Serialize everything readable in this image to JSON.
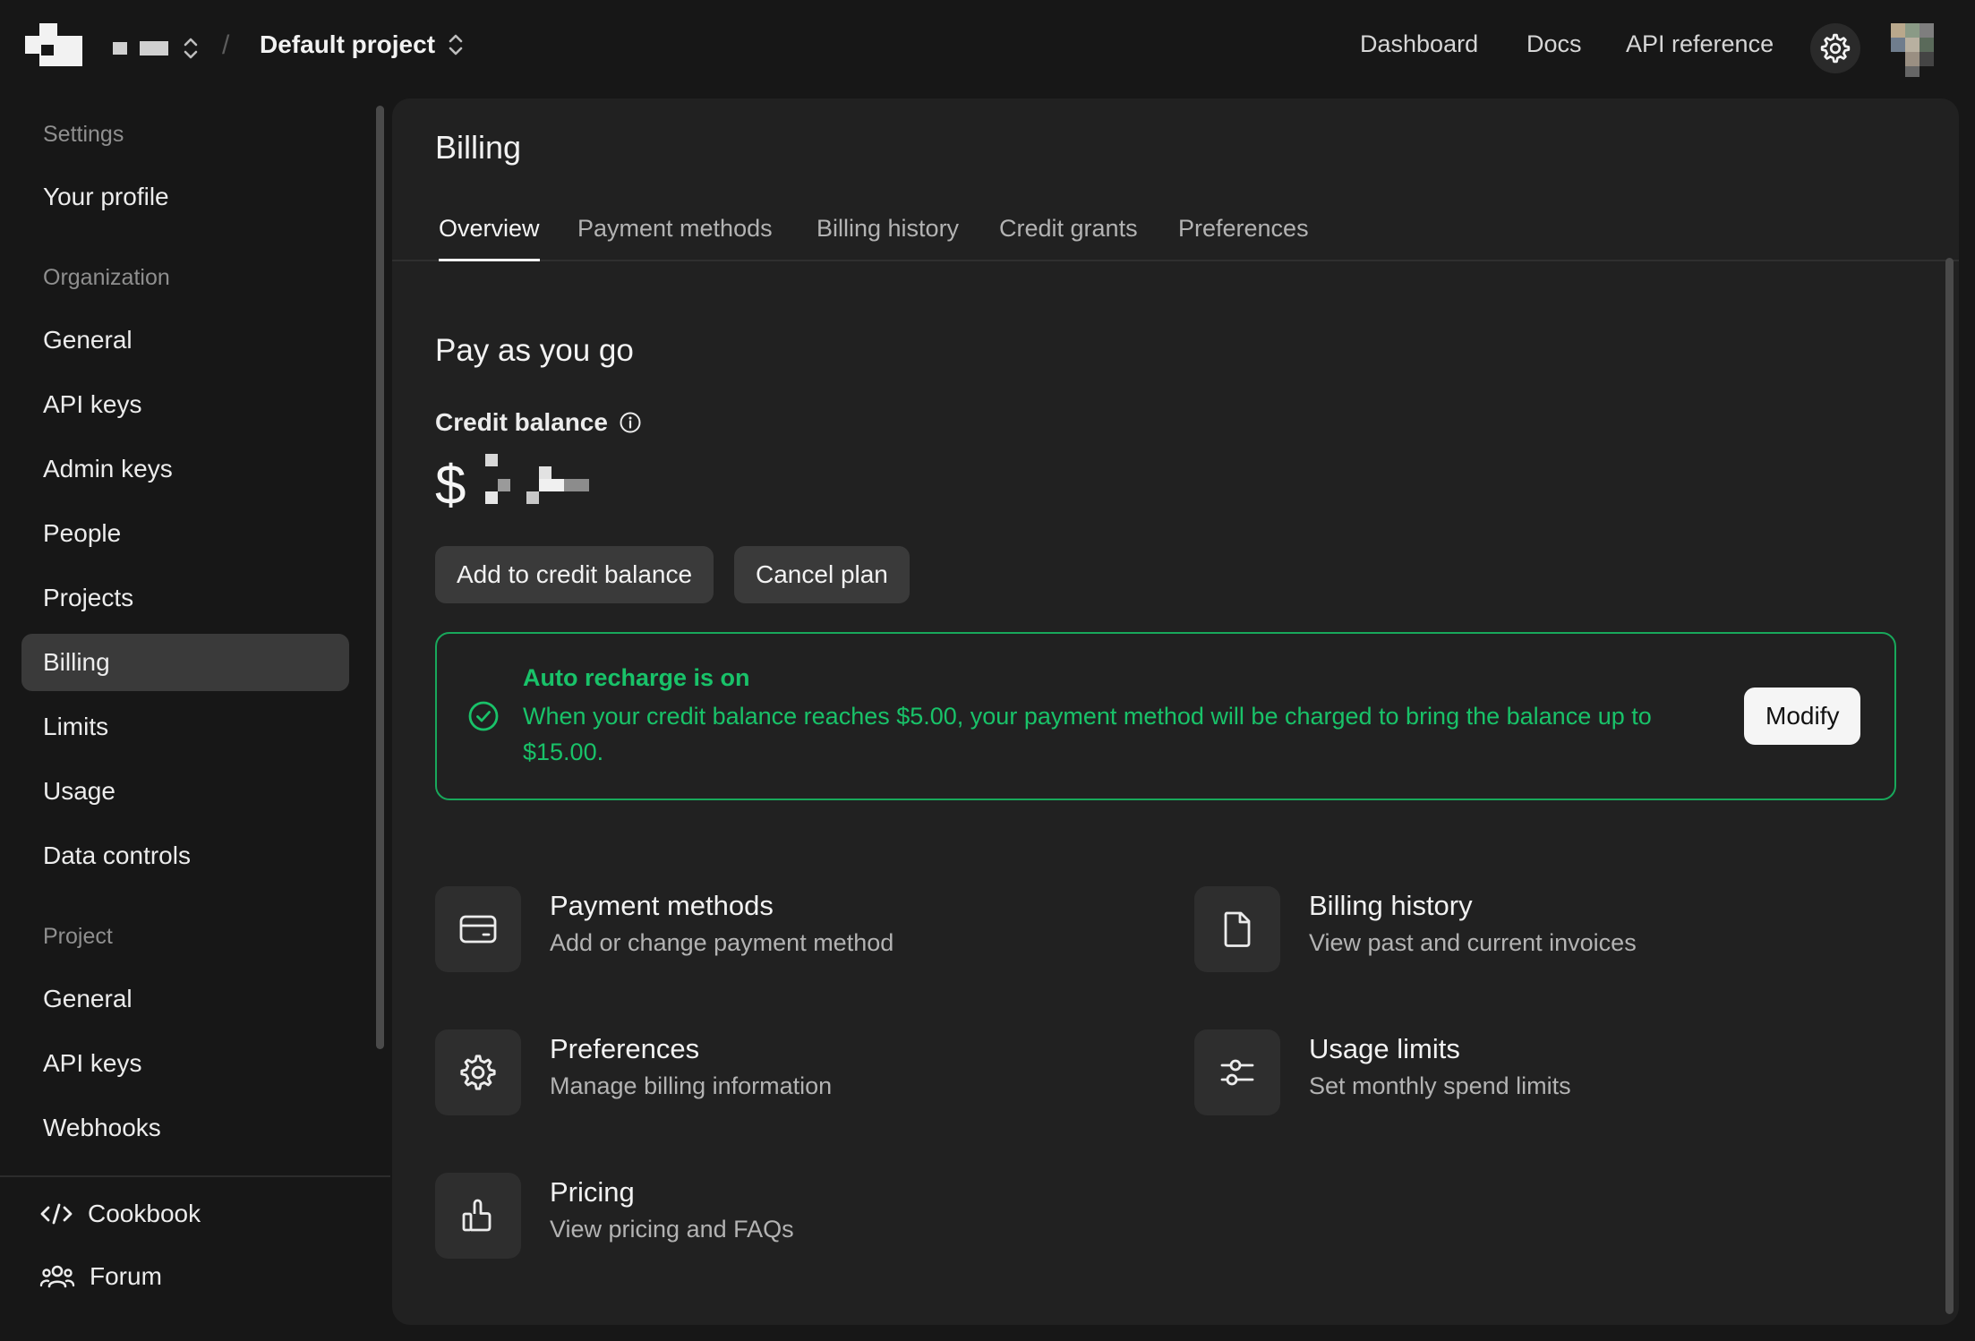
{
  "topbar": {
    "project_name": "Default project",
    "separator": "/",
    "links": [
      "Dashboard",
      "Docs",
      "API reference"
    ]
  },
  "sidebar": {
    "settings_header": "Settings",
    "your_profile": "Your profile",
    "organization_header": "Organization",
    "org_items": [
      "General",
      "API keys",
      "Admin keys",
      "People",
      "Projects",
      "Billing",
      "Limits",
      "Usage",
      "Data controls"
    ],
    "project_header": "Project",
    "project_items": [
      "General",
      "API keys",
      "Webhooks"
    ],
    "footer": {
      "cookbook": "Cookbook",
      "forum": "Forum"
    },
    "active_item": "Billing"
  },
  "main": {
    "title": "Billing",
    "tabs": [
      "Overview",
      "Payment methods",
      "Billing history",
      "Credit grants",
      "Preferences"
    ],
    "active_tab": "Overview",
    "plan_heading": "Pay as you go",
    "credit_label": "Credit balance",
    "currency_symbol": "$",
    "add_credit_label": "Add to credit balance",
    "cancel_plan_label": "Cancel plan",
    "auto_recharge": {
      "title": "Auto recharge is on",
      "text": "When your credit balance reaches $5.00, your payment method will be charged to bring the balance up to $15.00.",
      "modify_label": "Modify",
      "color": "#19c269"
    },
    "cards": [
      {
        "title": "Payment methods",
        "subtitle": "Add or change payment method",
        "icon": "credit-card-icon"
      },
      {
        "title": "Billing history",
        "subtitle": "View past and current invoices",
        "icon": "document-icon"
      },
      {
        "title": "Preferences",
        "subtitle": "Manage billing information",
        "icon": "gear-icon"
      },
      {
        "title": "Usage limits",
        "subtitle": "Set monthly spend limits",
        "icon": "sliders-icon"
      },
      {
        "title": "Pricing",
        "subtitle": "View pricing and FAQs",
        "icon": "thumbs-up-icon"
      }
    ]
  }
}
